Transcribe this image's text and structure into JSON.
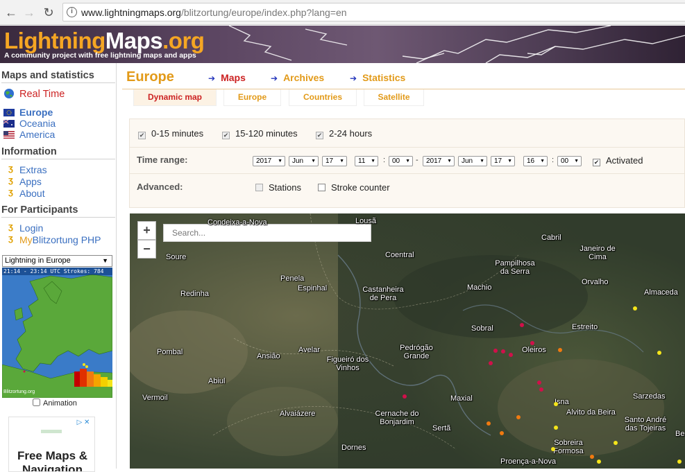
{
  "browser": {
    "url_host": "www.lightningmaps.org",
    "url_path": "/blitzortung/europe/index.php?lang=en",
    "back_icon": "back-arrow-icon",
    "forward_icon": "forward-arrow-icon",
    "reload_icon": "reload-icon"
  },
  "banner": {
    "logo_part1": "Lightning",
    "logo_part2": "Maps",
    "logo_part3": ".org",
    "tagline": "A community project with free lightning maps and apps"
  },
  "sidebar": {
    "maps_heading": "Maps and statistics",
    "realtime": "Real Time",
    "regions": [
      "Europe",
      "Oceania",
      "America"
    ],
    "info_heading": "Information",
    "info_links": [
      "Extras",
      "Apps",
      "About"
    ],
    "participants_heading": "For Participants",
    "login": "Login",
    "my_prefix": "My",
    "my_link": "Blitzortung PHP",
    "mini_select": "Lightning in Europe",
    "mini_caption": "21:14 - 23:14 UTC  Strokes: 784",
    "mini_watermark": "Blitzortung.org",
    "animation": "Animation",
    "ad_title": "Free Maps & Navigation"
  },
  "main": {
    "title": "Europe",
    "topnav": [
      "Maps",
      "Archives",
      "Statistics"
    ],
    "subtabs": [
      "Dynamic map",
      "Europe",
      "Countries",
      "Satellite"
    ]
  },
  "options": {
    "age_filters": [
      "0-15 minutes",
      "15-120 minutes",
      "2-24 hours"
    ],
    "time_range_label": "Time range:",
    "from": {
      "year": "2017",
      "month": "Jun",
      "day": "17",
      "hour": "11",
      "minute": "00"
    },
    "to": {
      "year": "2017",
      "month": "Jun",
      "day": "17",
      "hour": "16",
      "minute": "00"
    },
    "colon": ":",
    "dash": "-",
    "activated": "Activated",
    "advanced_label": "Advanced:",
    "stations": "Stations",
    "stroke_counter": "Stroke counter"
  },
  "map": {
    "zoom_in": "+",
    "zoom_out": "−",
    "search_placeholder": "Search...",
    "places": [
      "Condeixa-a-Nova",
      "Lousã",
      "Cabril",
      "Janeiro de Cima",
      "Soure",
      "Coentral",
      "Pampilhosa da Serra",
      "Penela",
      "Espinhal",
      "Castanheira de Pera",
      "Machio",
      "Orvalho",
      "Redinha",
      "Almaceda",
      "Sobral",
      "Estreito",
      "Pombal",
      "Ansião",
      "Avelar",
      "Pedrógão Grande",
      "Oleiros",
      "Figueiró dos Vinhos",
      "Abiul",
      "Vermoil",
      "Maxial",
      "Isna",
      "Alvito da Beira",
      "Sarzedas",
      "Alvaiázere",
      "Cernache do Bonjardim",
      "Sertã",
      "Santo André das Tojeiras",
      "Dornes",
      "Sobreira Formosa",
      "Proença-a-Nova",
      "Be"
    ],
    "strike_colors": {
      "recent": "#d0104a",
      "mid": "#f07a10",
      "old": "#f5e51a"
    }
  }
}
